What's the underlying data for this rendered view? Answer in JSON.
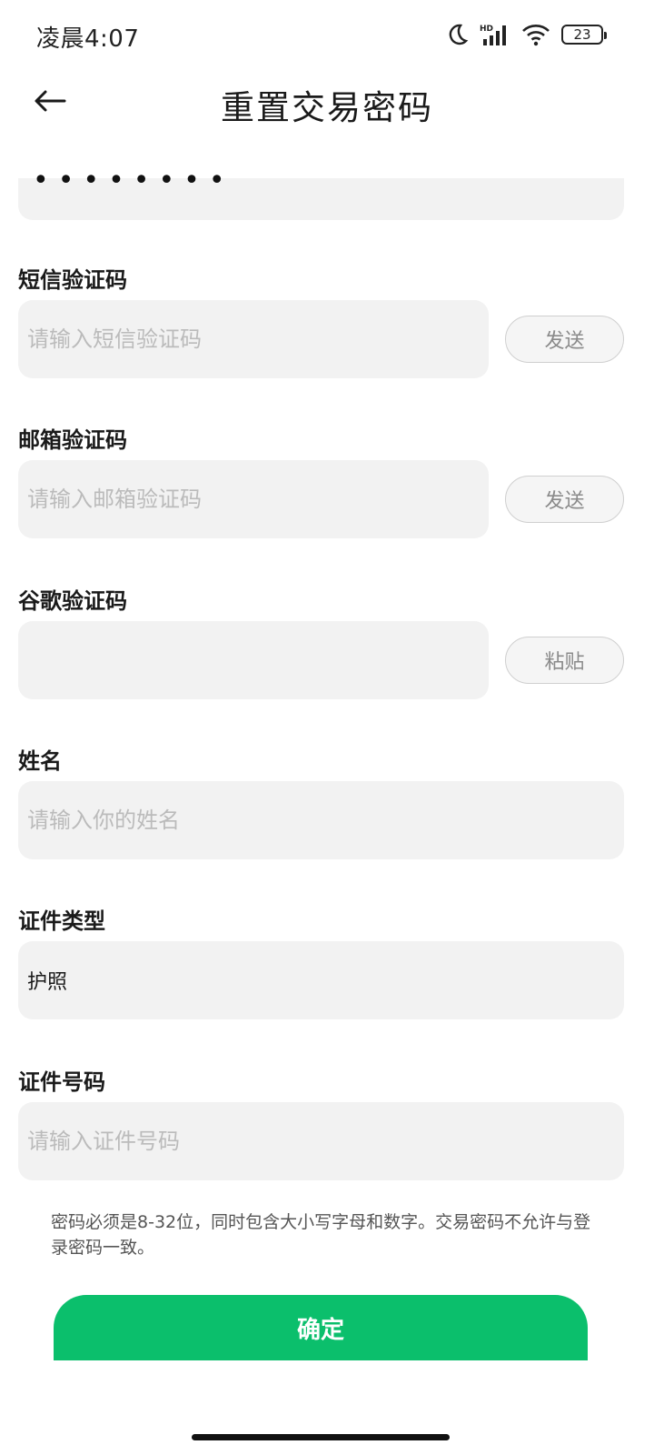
{
  "status_bar": {
    "time": "凌晨4:07",
    "battery": "23",
    "icons": [
      "moon-icon",
      "hd-signal-icon",
      "wifi-icon",
      "battery-icon"
    ]
  },
  "header": {
    "title": "重置交易密码",
    "back_icon": "arrow-left-icon"
  },
  "password_field": {
    "masked_value": "••••••••"
  },
  "sms_code": {
    "label": "短信验证码",
    "placeholder": "请输入短信验证码",
    "button": "发送"
  },
  "email_code": {
    "label": "邮箱验证码",
    "placeholder": "请输入邮箱验证码",
    "button": "发送"
  },
  "google_code": {
    "label": "谷歌验证码",
    "placeholder": "",
    "button": "粘贴"
  },
  "name": {
    "label": "姓名",
    "placeholder": "请输入你的姓名"
  },
  "id_type": {
    "label": "证件类型",
    "value": "护照"
  },
  "id_number": {
    "label": "证件号码",
    "placeholder": "请输入证件号码"
  },
  "hint": "密码必须是8-32位，同时包含大小写字母和数字。交易密码不允许与登录密码一致。",
  "confirm_button": "确定",
  "colors": {
    "accent": "#0bbf6c",
    "field_bg": "#f2f2f2",
    "placeholder": "#bbbbbb"
  }
}
